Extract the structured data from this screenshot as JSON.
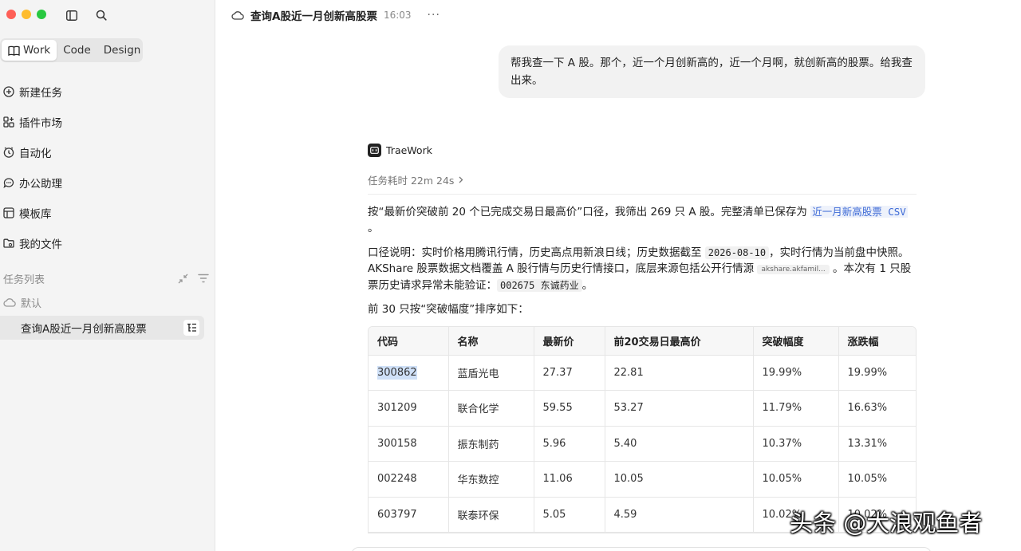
{
  "sidebar": {
    "tabs": [
      {
        "label": "Work"
      },
      {
        "label": "Code"
      },
      {
        "label": "Design"
      }
    ],
    "nav": [
      {
        "label": "新建任务",
        "icon": "plus-circle-icon"
      },
      {
        "label": "插件市场",
        "icon": "plugin-grid-icon"
      },
      {
        "label": "自动化",
        "icon": "clock-icon"
      },
      {
        "label": "办公助理",
        "icon": "chat-bubble-icon"
      },
      {
        "label": "模板库",
        "icon": "template-icon"
      },
      {
        "label": "我的文件",
        "icon": "folder-icon"
      }
    ],
    "section_title": "任务列表",
    "group_label": "默认",
    "task": {
      "label": "查询A股近一月创新高股票"
    }
  },
  "header": {
    "title": "查询A股近一月创新高股票",
    "time": "16:03",
    "more": "···"
  },
  "user_message": "帮我查一下 A 股。那个，近一个月创新高的，近一个月啊，就创新高的股票。给我查出来。",
  "agent": {
    "name": "TraeWork",
    "duration": "任务耗时 22m 24s"
  },
  "response": {
    "p1_text": "按“最新价突破前 20 个已完成交易日最高价”口径，我筛出 269 只 A 股。完整清单已保存为 ",
    "p1_link": "近一月新高股票 CSV",
    "p1_end": "。",
    "p2_a": "口径说明：实时价格用腾讯行情，历史高点用新浪日线；历史数据截至 ",
    "p2_date": "2026-08-10",
    "p2_b": "，实时行情为当前盘中快照。AKShare 股票数据文档覆盖 A 股行情与历史行情接口，底层来源包括公开行情源 ",
    "p2_chip": "akshare.akfamil...",
    "p2_c": " 。本次有 1 只股票历史请求异常未能验证：",
    "p2_stock": "002675 东诚药业",
    "p2_d": "。",
    "p3": "前 30 只按“突破幅度”排序如下："
  },
  "table": {
    "headers": [
      "代码",
      "名称",
      "最新价",
      "前20交易日最高价",
      "突破幅度",
      "涨跌幅"
    ],
    "rows": [
      [
        "300862",
        "蓝盾光电",
        "27.37",
        "22.81",
        "19.99%",
        "19.99%"
      ],
      [
        "301209",
        "联合化学",
        "59.55",
        "53.27",
        "11.79%",
        "16.63%"
      ],
      [
        "300158",
        "振东制药",
        "5.96",
        "5.40",
        "10.37%",
        "13.31%"
      ],
      [
        "002248",
        "华东数控",
        "11.06",
        "10.05",
        "10.05%",
        "10.05%"
      ],
      [
        "603797",
        "联泰环保",
        "5.05",
        "4.59",
        "10.02%",
        "10.02%"
      ]
    ]
  },
  "watermark": "头条 @大浪观鱼者"
}
